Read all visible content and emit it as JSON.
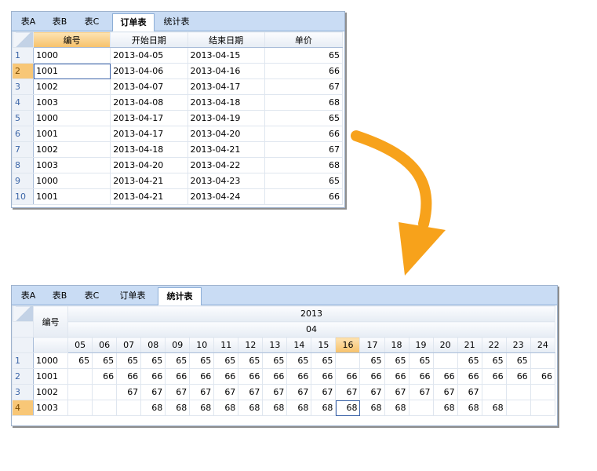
{
  "top": {
    "tabs": [
      "表A",
      "表B",
      "表C",
      "订单表",
      "统计表"
    ],
    "active_tab": "订单表",
    "headers": [
      "编号",
      "开始日期",
      "结束日期",
      "单价"
    ],
    "rows": [
      {
        "n": "1",
        "id": "1000",
        "start": "2013-04-05",
        "end": "2013-04-15",
        "price": "65"
      },
      {
        "n": "2",
        "id": "1001",
        "start": "2013-04-06",
        "end": "2013-04-16",
        "price": "66"
      },
      {
        "n": "3",
        "id": "1002",
        "start": "2013-04-07",
        "end": "2013-04-17",
        "price": "67"
      },
      {
        "n": "4",
        "id": "1003",
        "start": "2013-04-08",
        "end": "2013-04-18",
        "price": "68"
      },
      {
        "n": "5",
        "id": "1000",
        "start": "2013-04-17",
        "end": "2013-04-19",
        "price": "65"
      },
      {
        "n": "6",
        "id": "1001",
        "start": "2013-04-17",
        "end": "2013-04-20",
        "price": "66"
      },
      {
        "n": "7",
        "id": "1002",
        "start": "2013-04-18",
        "end": "2013-04-21",
        "price": "67"
      },
      {
        "n": "8",
        "id": "1003",
        "start": "2013-04-20",
        "end": "2013-04-22",
        "price": "68"
      },
      {
        "n": "9",
        "id": "1000",
        "start": "2013-04-21",
        "end": "2013-04-23",
        "price": "65"
      },
      {
        "n": "10",
        "id": "1001",
        "start": "2013-04-21",
        "end": "2013-04-24",
        "price": "66"
      }
    ]
  },
  "bottom": {
    "tabs": [
      "表A",
      "表B",
      "表C",
      "订单表",
      "统计表"
    ],
    "active_tab": "统计表",
    "id_header": "编号",
    "year": "2013",
    "month": "04",
    "days": [
      "05",
      "06",
      "07",
      "08",
      "09",
      "10",
      "11",
      "12",
      "13",
      "14",
      "15",
      "16",
      "17",
      "18",
      "19",
      "20",
      "21",
      "22",
      "23",
      "24"
    ],
    "rows": [
      {
        "n": "1",
        "id": "1000",
        "values": [
          "65",
          "65",
          "65",
          "65",
          "65",
          "65",
          "65",
          "65",
          "65",
          "65",
          "65",
          "",
          "65",
          "65",
          "65",
          "",
          "65",
          "65",
          "65",
          ""
        ]
      },
      {
        "n": "2",
        "id": "1001",
        "values": [
          "",
          "66",
          "66",
          "66",
          "66",
          "66",
          "66",
          "66",
          "66",
          "66",
          "66",
          "66",
          "66",
          "66",
          "66",
          "66",
          "66",
          "66",
          "66",
          "66"
        ]
      },
      {
        "n": "3",
        "id": "1002",
        "values": [
          "",
          "",
          "67",
          "67",
          "67",
          "67",
          "67",
          "67",
          "67",
          "67",
          "67",
          "67",
          "67",
          "67",
          "67",
          "67",
          "67",
          "",
          "",
          ""
        ]
      },
      {
        "n": "4",
        "id": "1003",
        "values": [
          "",
          "",
          "",
          "68",
          "68",
          "68",
          "68",
          "68",
          "68",
          "68",
          "68",
          "68",
          "68",
          "68",
          "",
          "68",
          "68",
          "68",
          "",
          ""
        ]
      }
    ]
  },
  "colors": {
    "arrow": "#f7a21b",
    "selected_header": "#f6c16a",
    "tab_bar": "#c9dcf4"
  }
}
